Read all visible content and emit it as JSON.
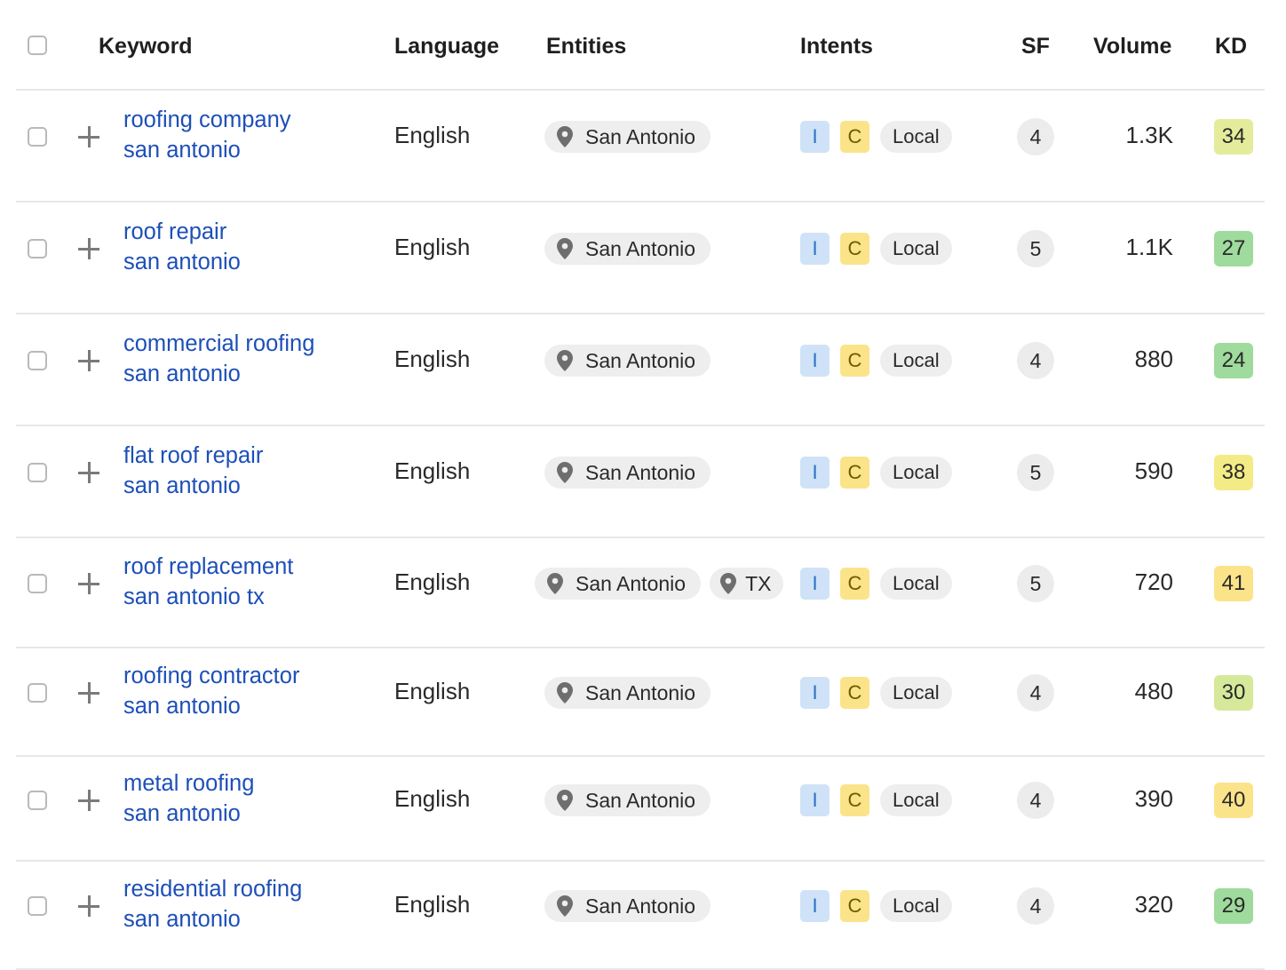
{
  "header": {
    "keyword": "Keyword",
    "language": "Language",
    "entities": "Entities",
    "intents": "Intents",
    "sf": "SF",
    "volume": "Volume",
    "kd": "KD"
  },
  "colors": {
    "link": "#1d4fb8",
    "kd_yellow_green": "#e4ec9c",
    "kd_green": "#9fdb9c",
    "kd_yellow": "#fbe38a",
    "intent_i": "#cfe2f7",
    "intent_c": "#fbe38a"
  },
  "rows": [
    {
      "kw1": "roofing company",
      "kw2": "san antonio",
      "language": "English",
      "entities": [
        "San Antonio"
      ],
      "intent_i": "I",
      "intent_c": "C",
      "intent_local": "Local",
      "sf": "4",
      "volume": "1.3K",
      "kd": "34",
      "kd_color": "#e4ec9c"
    },
    {
      "kw1": "roof repair",
      "kw2": "san antonio",
      "language": "English",
      "entities": [
        "San Antonio"
      ],
      "intent_i": "I",
      "intent_c": "C",
      "intent_local": "Local",
      "sf": "5",
      "volume": "1.1K",
      "kd": "27",
      "kd_color": "#9fdb9c"
    },
    {
      "kw1": "commercial roofing",
      "kw2": "san antonio",
      "language": "English",
      "entities": [
        "San Antonio"
      ],
      "intent_i": "I",
      "intent_c": "C",
      "intent_local": "Local",
      "sf": "4",
      "volume": "880",
      "kd": "24",
      "kd_color": "#9fdb9c"
    },
    {
      "kw1": "flat roof repair",
      "kw2": "san antonio",
      "language": "English",
      "entities": [
        "San Antonio"
      ],
      "intent_i": "I",
      "intent_c": "C",
      "intent_local": "Local",
      "sf": "5",
      "volume": "590",
      "kd": "38",
      "kd_color": "#f3ec86"
    },
    {
      "kw1": "roof replacement",
      "kw2": "san antonio tx",
      "language": "English",
      "entities": [
        "San Antonio",
        "TX"
      ],
      "intent_i": "I",
      "intent_c": "C",
      "intent_local": "Local",
      "sf": "5",
      "volume": "720",
      "kd": "41",
      "kd_color": "#fbe38a"
    },
    {
      "kw1": "roofing contractor",
      "kw2": "san antonio",
      "language": "English",
      "entities": [
        "San Antonio"
      ],
      "intent_i": "I",
      "intent_c": "C",
      "intent_local": "Local",
      "sf": "4",
      "volume": "480",
      "kd": "30",
      "kd_color": "#d6e99a"
    },
    {
      "kw1": "metal roofing",
      "kw2": "san antonio",
      "language": "English",
      "entities": [
        "San Antonio"
      ],
      "intent_i": "I",
      "intent_c": "C",
      "intent_local": "Local",
      "sf": "4",
      "volume": "390",
      "kd": "40",
      "kd_color": "#fbe38a"
    },
    {
      "kw1": "residential roofing",
      "kw2": "san antonio",
      "language": "English",
      "entities": [
        "San Antonio"
      ],
      "intent_i": "I",
      "intent_c": "C",
      "intent_local": "Local",
      "sf": "4",
      "volume": "320",
      "kd": "29",
      "kd_color": "#9fdb9c"
    }
  ]
}
